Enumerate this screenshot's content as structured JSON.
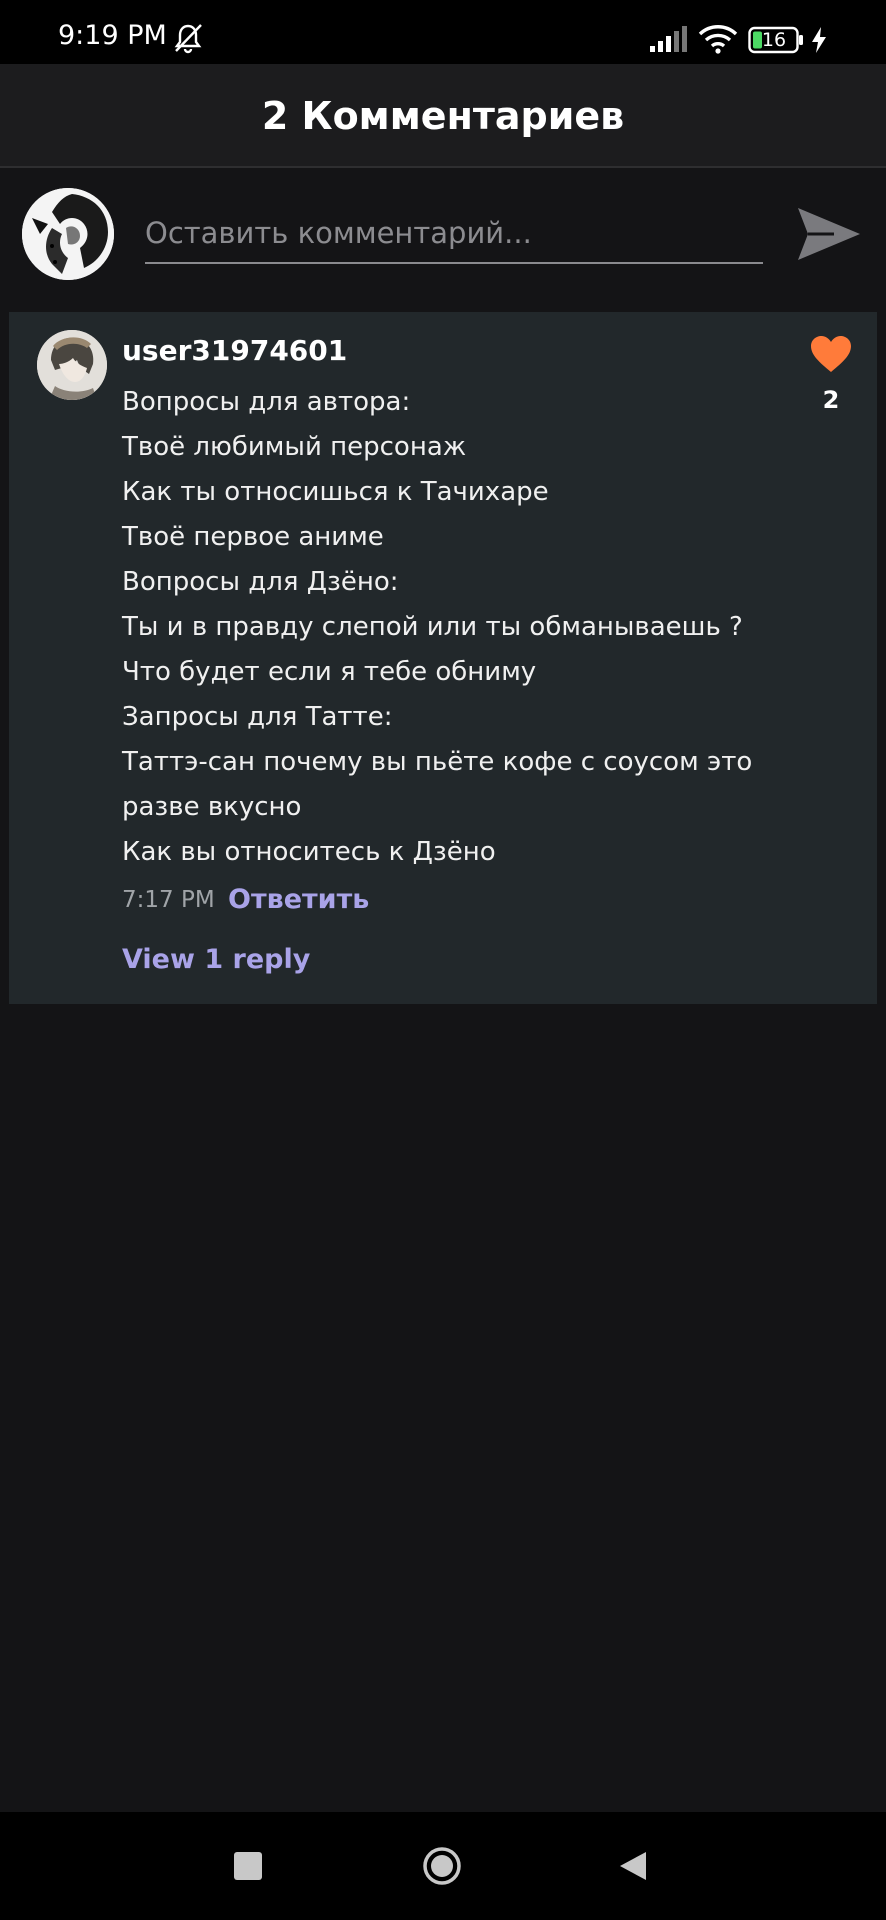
{
  "status_bar": {
    "time": "9:19 PM",
    "battery_level": "16",
    "icons": [
      "bell-off-icon",
      "signal-icon",
      "wifi-icon",
      "battery-icon",
      "charging-bolt-icon"
    ]
  },
  "header": {
    "title": "2 Комментариев"
  },
  "composer": {
    "placeholder": "Оставить комментарий...",
    "send_icon": "send-icon"
  },
  "comment": {
    "username": "user31974601",
    "lines": [
      "Вопросы для автора:",
      "Твоё любимый персонаж",
      "Как ты относишься к Тачихаре",
      "Твоё первое аниме",
      "Вопросы для Дзёно:",
      "Ты и в правду слепой или ты обманываешь ?",
      "Что будет если я тебе обниму",
      "Запросы для Татте:",
      "Таттэ-сан почему вы пьёте кофе с соусом это",
      "разве вкусно",
      "Как вы относитесь к Дзёно"
    ],
    "time": "7:17 PM",
    "reply_label": "Ответить",
    "view_replies_label": "View 1 reply",
    "like_count": "2",
    "like_icon": "heart-icon"
  },
  "nav_bar": {
    "icons": [
      "recents-icon",
      "home-icon",
      "back-icon"
    ]
  },
  "colors": {
    "background": "#141416",
    "card": "#22282b",
    "accent_link": "#a9a3e8",
    "heart": "#ff7b3a"
  }
}
